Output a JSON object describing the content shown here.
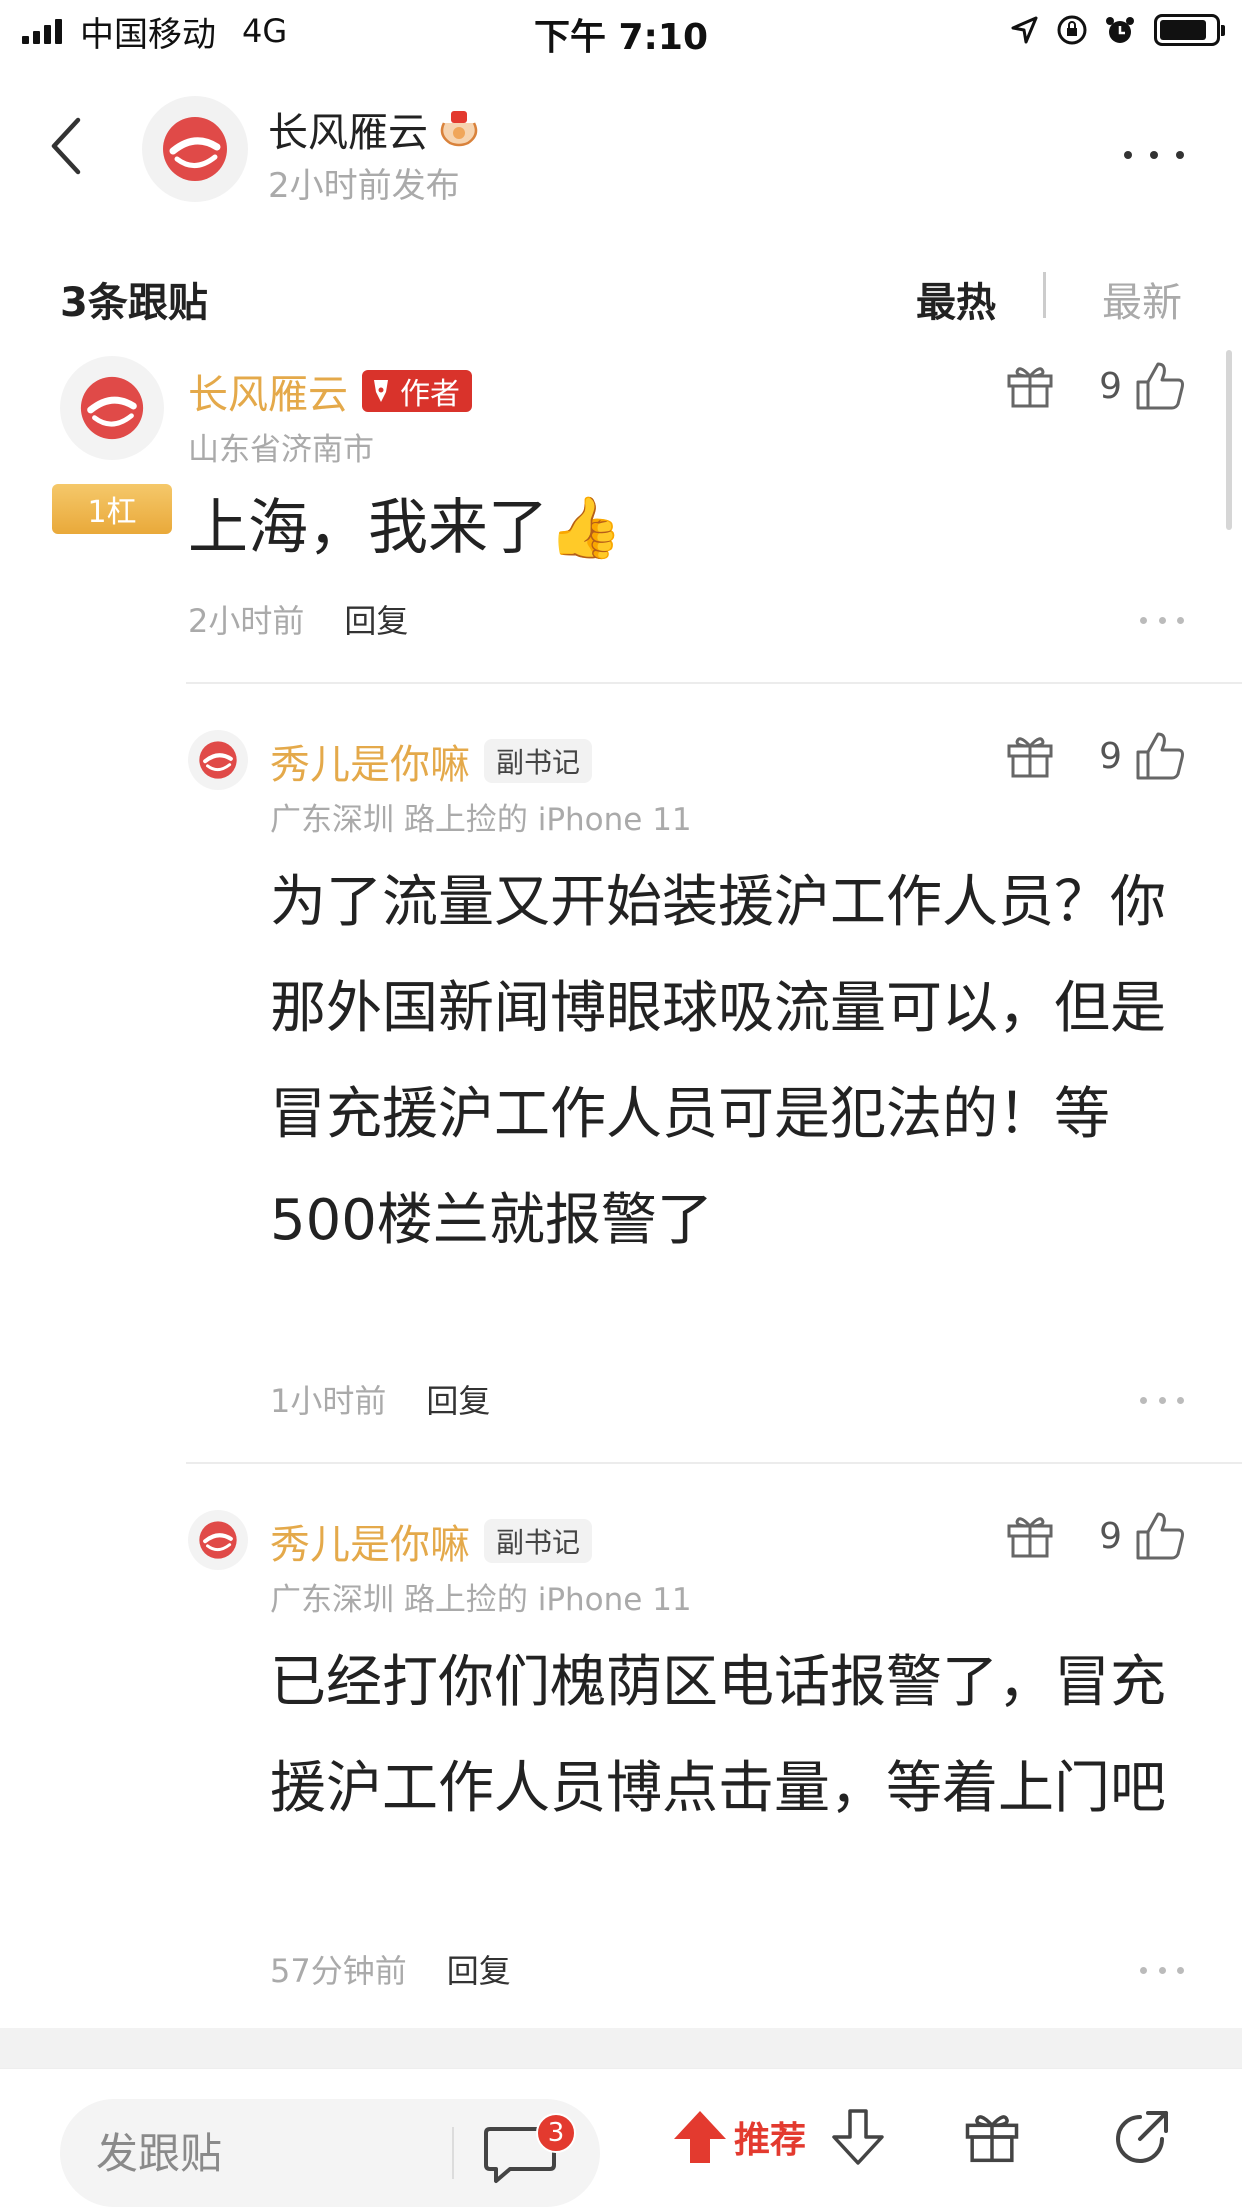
{
  "status_bar": {
    "carrier": "中国移动",
    "network": "4G",
    "time": "下午 7:10"
  },
  "header": {
    "author_name": "长风雁云",
    "post_time": "2小时前发布"
  },
  "sort": {
    "reply_count": "3条跟贴",
    "hot_label": "最热",
    "new_label": "最新"
  },
  "comments": [
    {
      "name": "长风雁云",
      "author_badge": "作者",
      "location": "山东省济南市",
      "floor": "1杠",
      "text": "上海，我来了👍",
      "time": "2小时前",
      "reply_label": "回复",
      "likes": "9"
    },
    {
      "name": "秀儿是你嘛",
      "rank": "副书记",
      "location": "广东深圳 路上捡的 iPhone 11",
      "text": "为了流量又开始装援沪工作人员？你那外国新闻博眼球吸流量可以，但是冒充援沪工作人员可是犯法的！等500楼兰就报警了",
      "time": "1小时前",
      "reply_label": "回复",
      "likes": "9"
    },
    {
      "name": "秀儿是你嘛",
      "rank": "副书记",
      "location": "广东深圳 路上捡的 iPhone 11",
      "text": "已经打你们槐荫区电话报警了，冒充援沪工作人员博点击量，等着上门吧",
      "time": "57分钟前",
      "reply_label": "回复",
      "likes": "9"
    }
  ],
  "bottom_bar": {
    "input_placeholder": "发跟贴",
    "comment_badge": "3",
    "recommend_label": "推荐"
  },
  "colors": {
    "accent_red": "#e33a2f",
    "username_gold": "#e4a94a",
    "muted_gray": "#aaaaaa"
  },
  "icons": [
    "signal-icon",
    "location-arrow-icon",
    "orientation-lock-icon",
    "alarm-icon",
    "battery-icon",
    "back-icon",
    "more-icon",
    "gift-icon",
    "thumbs-up-icon",
    "comment-icon",
    "up-arrow-icon",
    "down-arrow-icon",
    "share-icon"
  ]
}
